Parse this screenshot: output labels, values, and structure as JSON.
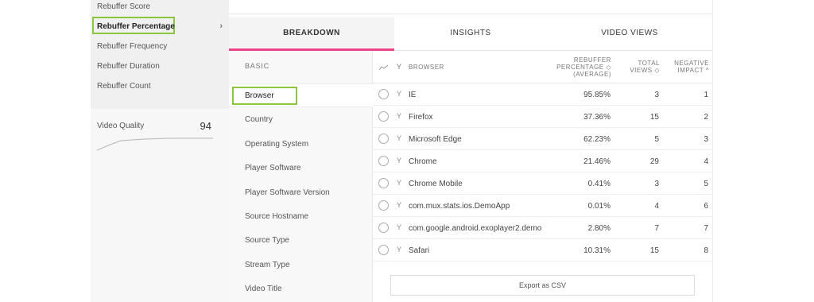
{
  "sidebar": {
    "metrics": [
      {
        "label": "Rebuffer Score"
      },
      {
        "label": "Rebuffer Percentage",
        "active": true
      },
      {
        "label": "Rebuffer Frequency"
      },
      {
        "label": "Rebuffer Duration"
      },
      {
        "label": "Rebuffer Count"
      }
    ],
    "chevron": "›",
    "quality": {
      "label": "Video Quality",
      "score": "94"
    }
  },
  "tabs": [
    "BREAKDOWN",
    "INSIGHTS",
    "VIDEO VIEWS"
  ],
  "categories": {
    "header": "BASIC",
    "items": [
      "Browser",
      "Country",
      "Operating System",
      "Player Software",
      "Player Software Version",
      "Source Hostname",
      "Source Type",
      "Stream Type",
      "Video Title"
    ],
    "active_index": 0
  },
  "table": {
    "headers": {
      "trend_icon": "trend-icon",
      "filter_icon": "filter-icon",
      "browser": "BROWSER",
      "rebuffer_line1": "REBUFFER",
      "rebuffer_line2": "PERCENTAGE ◇",
      "rebuffer_line3": "(AVERAGE)",
      "views_line1": "TOTAL",
      "views_line2": "VIEWS ◇",
      "impact_line1": "NEGATIVE",
      "impact_line2": "IMPACT ^"
    },
    "filter_glyph": "Y",
    "rows": [
      {
        "browser": "IE",
        "pct": "95.85%",
        "views": "3",
        "impact": "1"
      },
      {
        "browser": "Firefox",
        "pct": "37.36%",
        "views": "15",
        "impact": "2"
      },
      {
        "browser": "Microsoft Edge",
        "pct": "62.23%",
        "views": "5",
        "impact": "3"
      },
      {
        "browser": "Chrome",
        "pct": "21.46%",
        "views": "29",
        "impact": "4"
      },
      {
        "browser": "Chrome Mobile",
        "pct": "0.41%",
        "views": "3",
        "impact": "5"
      },
      {
        "browser": "com.mux.stats.ios.DemoApp",
        "pct": "0.01%",
        "views": "4",
        "impact": "6"
      },
      {
        "browser": "com.google.android.exoplayer2.demo",
        "pct": "2.80%",
        "views": "7",
        "impact": "7"
      },
      {
        "browser": "Safari",
        "pct": "10.31%",
        "views": "15",
        "impact": "8"
      }
    ],
    "export_label": "Export as CSV"
  },
  "colors": {
    "accent_pink": "#e8448b",
    "highlight_green": "#8cc63f"
  }
}
